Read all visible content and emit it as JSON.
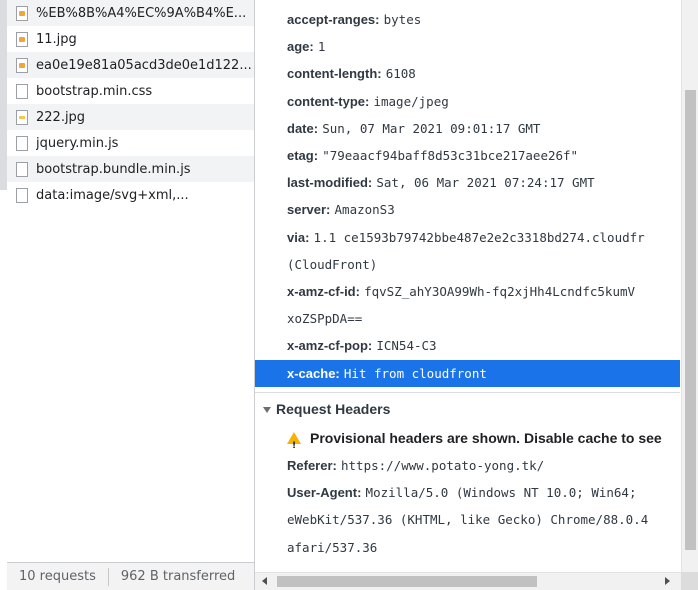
{
  "files": [
    {
      "name": "%EB%8B%A4%EC%9A%B4%E...",
      "icon": "image-file-icon"
    },
    {
      "name": "11.jpg",
      "icon": "image-file-icon"
    },
    {
      "name": "ea0e19e81a05acd3de0e1d122...",
      "icon": "image-file-icon"
    },
    {
      "name": "bootstrap.min.css",
      "icon": "document-file-icon"
    },
    {
      "name": "222.jpg",
      "icon": "image-file-icon"
    },
    {
      "name": "jquery.min.js",
      "icon": "document-file-icon"
    },
    {
      "name": "bootstrap.bundle.min.js",
      "icon": "document-file-icon"
    },
    {
      "name": "data:image/svg+xml,...",
      "icon": "document-file-icon"
    }
  ],
  "status": {
    "requests": "10 requests",
    "transferred": "962 B transferred"
  },
  "response_headers": [
    {
      "key": "accept-ranges:",
      "value": "bytes"
    },
    {
      "key": "age:",
      "value": "1"
    },
    {
      "key": "content-length:",
      "value": "6108"
    },
    {
      "key": "content-type:",
      "value": "image/jpeg"
    },
    {
      "key": "date:",
      "value": "Sun, 07 Mar 2021 09:01:17 GMT"
    },
    {
      "key": "etag:",
      "value": "\"79eaacf94baff8d53c31bce217aee26f\""
    },
    {
      "key": "last-modified:",
      "value": "Sat, 06 Mar 2021 07:24:17 GMT"
    },
    {
      "key": "server:",
      "value": "AmazonS3"
    },
    {
      "key": "via:",
      "value": "1.1 ce1593b79742bbe487e2e2c3318bd274.cloudfr"
    },
    {
      "key": "",
      "value": "(CloudFront)"
    },
    {
      "key": "x-amz-cf-id:",
      "value": "fqvSZ_ahY3OA99Wh-fq2xjHh4Lcndfc5kumV"
    },
    {
      "key": "",
      "value": "xoZSPpDA=="
    },
    {
      "key": "x-amz-cf-pop:",
      "value": "ICN54-C3"
    },
    {
      "key": "x-cache:",
      "value": "Hit from cloudfront",
      "selected": true
    }
  ],
  "request_section": {
    "title": "Request Headers",
    "warning": "Provisional headers are shown. Disable cache to see"
  },
  "request_headers": [
    {
      "key": "Referer:",
      "value": "https://www.potato-yong.tk/"
    },
    {
      "key": "User-Agent:",
      "value": "Mozilla/5.0 (Windows NT 10.0; Win64;"
    },
    {
      "key": "",
      "value": "eWebKit/537.36 (KHTML, like Gecko) Chrome/88.0.4"
    },
    {
      "key": "",
      "value": "afari/537.36"
    }
  ]
}
